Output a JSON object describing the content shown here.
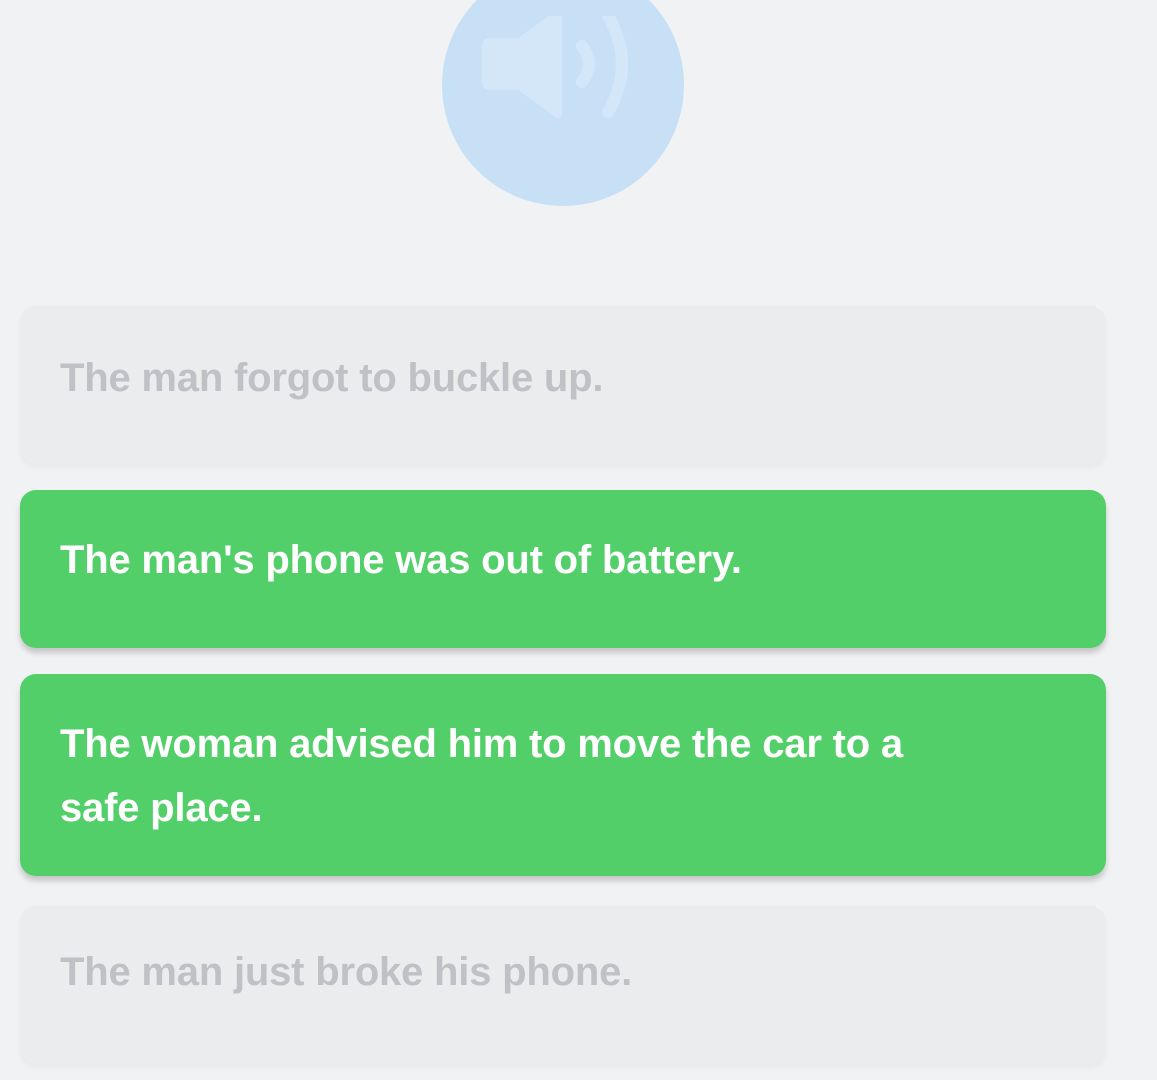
{
  "audio": {
    "icon": "speaker-icon",
    "color": "#c7e0f6"
  },
  "options": [
    {
      "text": "The man forgot to buckle up.",
      "state": "inactive"
    },
    {
      "text": "The man's phone was out of battery.",
      "state": "selected"
    },
    {
      "text": "The woman advised him to move the car to a safe place.",
      "state": "selected"
    },
    {
      "text": "The man just broke his phone.",
      "state": "inactive"
    }
  ],
  "colors": {
    "background": "#f1f2f4",
    "selected": "#53cf6a",
    "inactive_bg": "#ebecee",
    "inactive_text": "#bfc1c7"
  }
}
